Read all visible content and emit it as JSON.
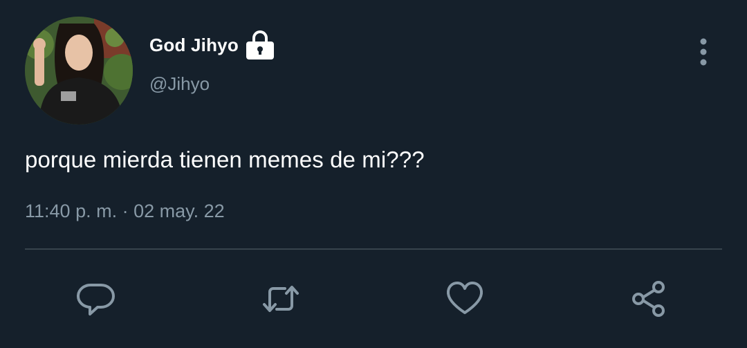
{
  "tweet": {
    "display_name": "God Jihyo",
    "handle": "@Jihyo",
    "text": "porque mierda tienen memes de mi???",
    "timestamp": "11:40 p. m. · 02 may. 22",
    "protected_icon": "lock-icon",
    "more_icon": "vertical-dots-icon"
  },
  "actions": [
    {
      "name": "reply",
      "icon": "speech-bubble-icon"
    },
    {
      "name": "retweet",
      "icon": "retweet-arrows-icon"
    },
    {
      "name": "like",
      "icon": "heart-icon"
    },
    {
      "name": "share",
      "icon": "share-nodes-icon"
    }
  ],
  "colors": {
    "background": "#15202b",
    "primary_text": "#ffffff",
    "secondary_text": "#8899a6",
    "divider": "#38444d",
    "icon": "#8899a6"
  }
}
